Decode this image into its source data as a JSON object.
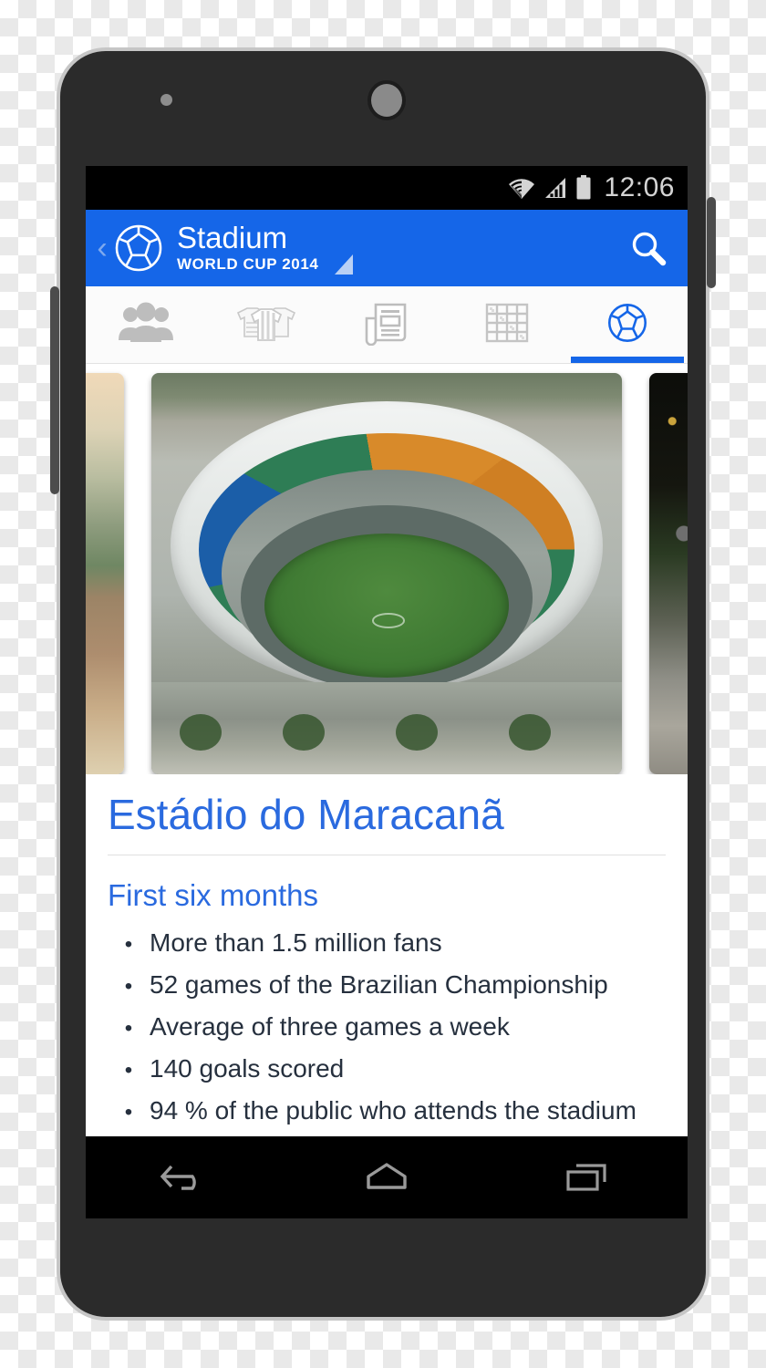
{
  "device": {
    "name": "android-smartphone",
    "sensor": "proximity-sensor",
    "camera": "front-camera",
    "volume_button": "volume-rocker",
    "power_button": "power-button"
  },
  "status_bar": {
    "wifi": "wifi-icon",
    "signal": "cellular-signal-icon",
    "battery": "battery-full-icon",
    "clock": "12:06"
  },
  "app_bar": {
    "back": "back-chevron-icon",
    "logo": "soccer-ball-icon",
    "title": "Stadium",
    "subtitle": "WORLD CUP 2014",
    "spinner": "dropdown-triangle-icon",
    "search": "search-icon",
    "background_color": "#1566e8",
    "title_color": "#ffffff"
  },
  "tabs": [
    {
      "id": "teams",
      "icon": "people-group-icon",
      "active": false
    },
    {
      "id": "kits",
      "icon": "jerseys-icon",
      "active": false
    },
    {
      "id": "news",
      "icon": "newspaper-icon",
      "active": false
    },
    {
      "id": "brackets",
      "icon": "grid-table-icon",
      "active": false
    },
    {
      "id": "stadiums",
      "icon": "soccer-ball-icon",
      "active": true
    }
  ],
  "tab_colors": {
    "inactive": "#bdbdbd",
    "active": "#1566e8",
    "indicator": "#1566e8"
  },
  "carousel": {
    "previous": {
      "name": "stadium-photo-previous",
      "description": "aerial sepia landscape"
    },
    "current": {
      "name": "stadium-photo-maracana",
      "description": "aerial view of Maracana stadium"
    },
    "next": {
      "name": "stadium-photo-next",
      "description": "night stadium exterior"
    }
  },
  "content": {
    "headline": "Estádio do Maracanã",
    "section_title": "First six months",
    "headline_color": "#2a6adf",
    "bullet_glyph": "•",
    "facts": [
      "More than 1.5 million fans",
      "52 games of the Brazilian Championship",
      "Average of three games a week",
      "140 goals scored",
      "94 % of the public who attends the stadium"
    ]
  },
  "nav_bar": {
    "back": "back-nav-icon",
    "home": "home-nav-icon",
    "recents": "recent-apps-nav-icon"
  }
}
